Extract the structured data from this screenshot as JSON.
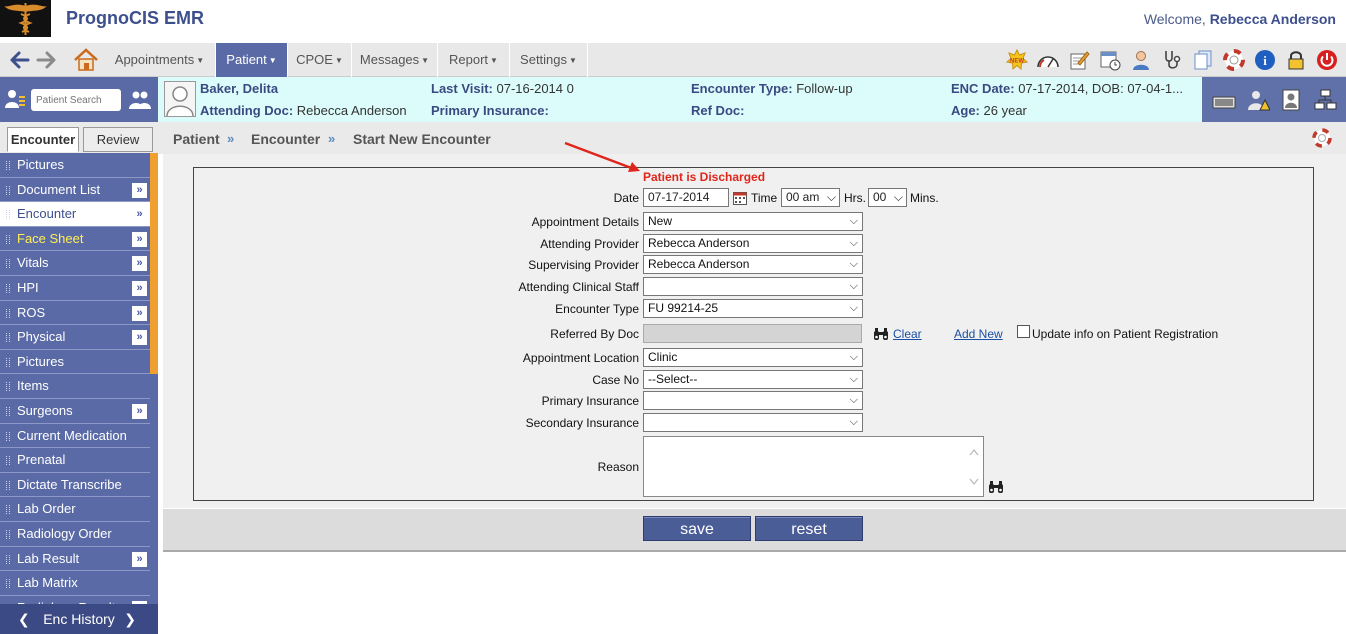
{
  "app": {
    "title": "PrognoCIS EMR",
    "welcome_prefix": "Welcome,",
    "user_name": "Rebecca Anderson"
  },
  "menu": [
    "Appointments",
    "Patient",
    "CPOE",
    "Messages",
    "Report",
    "Settings"
  ],
  "toolbar_icons": [
    "new-badge-icon",
    "dashboard-gauge-icon",
    "edit-note-icon",
    "calendar-clock-icon",
    "user-icon",
    "stethoscope-icon",
    "documents-icon",
    "lifebuoy-icon",
    "info-icon",
    "lock-icon",
    "power-icon"
  ],
  "search": {
    "placeholder": "Patient Search"
  },
  "banner": {
    "patient_name": "Baker, Delita",
    "attending_doc_label": "Attending Doc:",
    "attending_doc": "Rebecca Anderson",
    "last_visit_label": "Last Visit:",
    "last_visit": "07-16-2014 0",
    "primary_insurance_label": "Primary Insurance:",
    "primary_insurance": "",
    "encounter_type_label": "Encounter Type:",
    "encounter_type": "Follow-up",
    "ref_doc_label": "Ref Doc:",
    "ref_doc": "",
    "enc_date_label": "ENC Date:",
    "enc_date": "07-17-2014, DOB: 07-04-1...",
    "age_label": "Age:",
    "age": "26 year"
  },
  "left_tabs": {
    "encounter": "Encounter",
    "review": "Review"
  },
  "sidebar": [
    {
      "label": "Pictures",
      "more": false
    },
    {
      "label": "Document List",
      "more": true
    },
    {
      "label": "Encounter",
      "more": true,
      "selected": true
    },
    {
      "label": "Face Sheet",
      "more": true,
      "highlight": true
    },
    {
      "label": "Vitals",
      "more": true
    },
    {
      "label": "HPI",
      "more": true
    },
    {
      "label": "ROS",
      "more": true
    },
    {
      "label": "Physical",
      "more": true
    },
    {
      "label": "Pictures",
      "more": false
    },
    {
      "label": "Items",
      "more": false
    },
    {
      "label": "Surgeons",
      "more": true
    },
    {
      "label": "Current Medication",
      "more": false
    },
    {
      "label": "Prenatal",
      "more": false
    },
    {
      "label": "Dictate Transcribe",
      "more": false
    },
    {
      "label": "Lab Order",
      "more": false
    },
    {
      "label": "Radiology Order",
      "more": false
    },
    {
      "label": "Lab Result",
      "more": true
    },
    {
      "label": "Lab Matrix",
      "more": false
    },
    {
      "label": "Radiology Result",
      "more": true
    }
  ],
  "enc_history": "Enc History",
  "breadcrumb": [
    "Patient",
    "Encounter",
    "Start New Encounter"
  ],
  "breadcrumb_sep": "»",
  "form": {
    "status": "Patient is Discharged",
    "date_label": "Date",
    "date_value": "07-17-2014",
    "time_label": "Time",
    "time_hour": "00 am",
    "hrs_label": "Hrs.",
    "time_min": "00",
    "mins_label": "Mins.",
    "appointment_details_label": "Appointment Details",
    "appointment_details": "New",
    "attending_provider_label": "Attending Provider",
    "attending_provider": "Rebecca Anderson",
    "supervising_provider_label": "Supervising Provider",
    "supervising_provider": "Rebecca Anderson",
    "attending_clinical_staff_label": "Attending Clinical Staff",
    "attending_clinical_staff": "",
    "encounter_type_label": "Encounter Type",
    "encounter_type": "FU 99214-25",
    "referred_by_doc_label": "Referred By Doc",
    "referred_by_doc": "",
    "clear_link": "Clear",
    "add_new_link": "Add New",
    "update_info_label": "Update info on Patient Registration",
    "appointment_location_label": "Appointment Location",
    "appointment_location": "Clinic",
    "case_no_label": "Case No",
    "case_no": "--Select--",
    "primary_insurance_label": "Primary Insurance",
    "primary_insurance": "",
    "secondary_insurance_label": "Secondary Insurance",
    "secondary_insurance": "",
    "reason_label": "Reason",
    "reason": ""
  },
  "buttons": {
    "save": "save",
    "reset": "reset"
  },
  "colors": {
    "brand": "#3d4f8c",
    "sidebar": "#5a6aa6",
    "banner": "#dcfcfc",
    "alert": "#e0251b",
    "highlight": "#ffee55"
  }
}
